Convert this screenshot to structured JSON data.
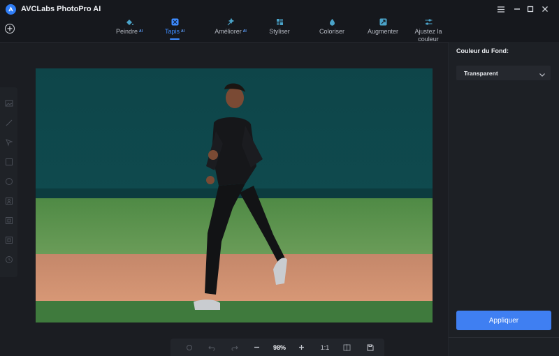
{
  "app": {
    "title": "AVCLabs PhotoPro AI"
  },
  "tabs": [
    {
      "label": "Peindre",
      "badge": "AI"
    },
    {
      "label": "Tapis",
      "badge": "AI"
    },
    {
      "label": "Améliorer",
      "badge": "AI"
    },
    {
      "label": "Styliser",
      "badge": ""
    },
    {
      "label": "Coloriser",
      "badge": ""
    },
    {
      "label": "Augmenter",
      "badge": ""
    },
    {
      "label_line1": "Ajustez la",
      "label_line2": "couleur"
    }
  ],
  "active_tab": "Tapis",
  "panel": {
    "background_label": "Couleur du Fond:",
    "background_value": "Transparent",
    "apply_label": "Appliquer"
  },
  "bottom_toolbar": {
    "zoom": "98%",
    "ratio": "1:1"
  },
  "colors": {
    "accent": "#3d8bff",
    "apply_button": "#3f7ff2",
    "background": "#16181d",
    "panel": "#1d2025"
  }
}
